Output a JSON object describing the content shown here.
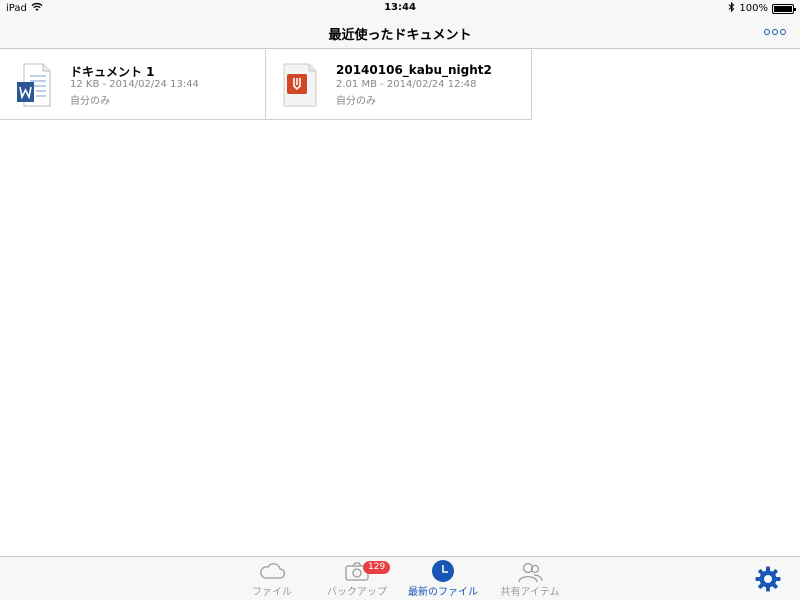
{
  "status_bar": {
    "device": "iPad",
    "time": "13:44",
    "battery": "100%"
  },
  "nav": {
    "title": "最近使ったドキュメント"
  },
  "files": [
    {
      "name": "ドキュメント 1",
      "meta": "12 KB - 2014/02/24 13:44",
      "owner": "自分のみ",
      "icon": "word-document-icon"
    },
    {
      "name": "20140106_kabu_night2",
      "meta": "2.01 MB - 2014/02/24 12:48",
      "owner": "自分のみ",
      "icon": "pdf-document-icon"
    }
  ],
  "tabs": [
    {
      "label": "ファイル",
      "icon": "cloud-icon",
      "active": false
    },
    {
      "label": "バックアップ",
      "icon": "camera-icon",
      "active": false,
      "badge": "129"
    },
    {
      "label": "最新のファイル",
      "icon": "clock-icon",
      "active": true
    },
    {
      "label": "共有アイテム",
      "icon": "people-icon",
      "active": false
    }
  ],
  "colors": {
    "accent": "#1a56b5",
    "badge": "#e84040",
    "word": "#2b5797",
    "pdf": "#d24726"
  }
}
